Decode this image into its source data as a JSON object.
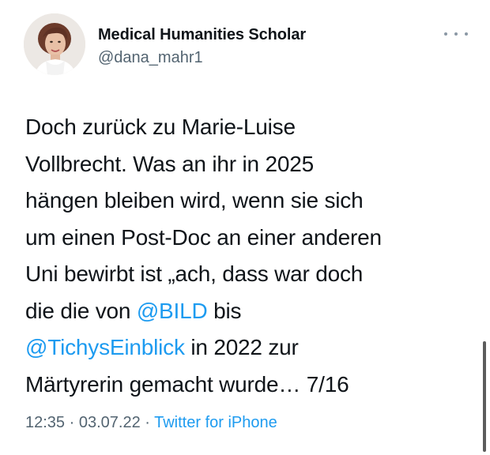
{
  "author": {
    "display_name": "Medical Humanities Scholar",
    "handle": "@dana_mahr1"
  },
  "icons": {
    "more": "more-horizontal-icon",
    "avatar": "profile-photo"
  },
  "tweet": {
    "lines": [
      {
        "segments": [
          {
            "text": "Doch zurück zu Marie-Luise"
          }
        ]
      },
      {
        "segments": [
          {
            "text": "Vollbrecht. Was an ihr in 2025"
          }
        ]
      },
      {
        "segments": [
          {
            "text": "hängen bleiben wird, wenn sie sich"
          }
        ]
      },
      {
        "segments": [
          {
            "text": "um einen Post-Doc an einer anderen"
          }
        ]
      },
      {
        "segments": [
          {
            "text": "Uni bewirbt ist „ach, dass war doch"
          }
        ]
      },
      {
        "segments": [
          {
            "text": "die die von "
          },
          {
            "text": "@BILD",
            "mention": true
          },
          {
            "text": " bis"
          }
        ]
      },
      {
        "segments": [
          {
            "text": "@TichysEinblick",
            "mention": true
          },
          {
            "text": " in 2022 zur"
          }
        ]
      },
      {
        "segments": [
          {
            "text": "Märtyrerin gemacht wurde… 7/16"
          }
        ]
      }
    ]
  },
  "meta": {
    "time": "12:35",
    "sep1": " · ",
    "date": "03.07.22",
    "sep2": " · ",
    "source": "Twitter for iPhone"
  },
  "colors": {
    "link": "#1d9bf0",
    "secondary_text": "#536471",
    "primary_text": "#0f1419"
  }
}
